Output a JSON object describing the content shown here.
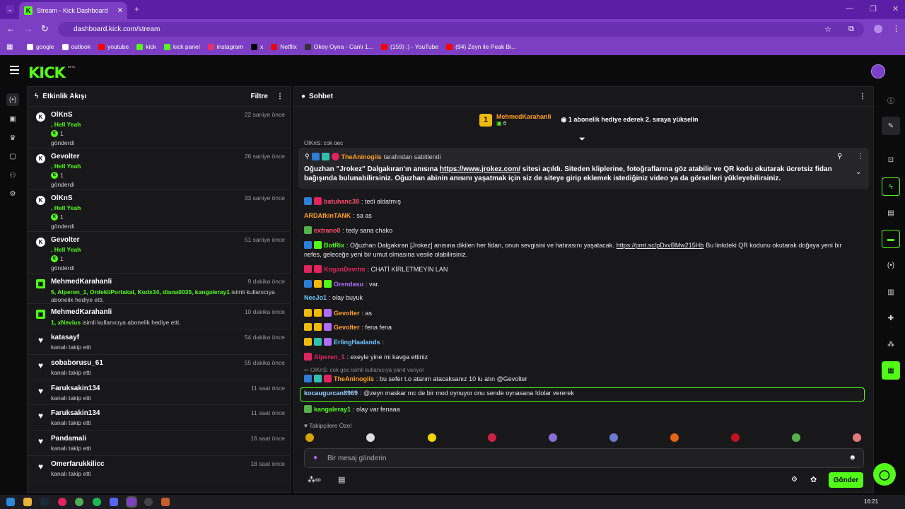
{
  "browser": {
    "tab_title": "Stream - Kick Dashboard",
    "url": "dashboard.kick.com/stream",
    "bookmarks": [
      {
        "label": "google",
        "color": "#ffffff"
      },
      {
        "label": "outlook",
        "color": "#ffffff"
      },
      {
        "label": "youtube",
        "color": "#ff0000"
      },
      {
        "label": "kick",
        "color": "#53fc18"
      },
      {
        "label": "kick panel",
        "color": "#53fc18"
      },
      {
        "label": "instagram",
        "color": "#e1306c"
      },
      {
        "label": "x",
        "color": "#000000"
      },
      {
        "label": "Netflix",
        "color": "#e50914"
      },
      {
        "label": "Okey Oyna - Canlı 1...",
        "color": "#333333"
      },
      {
        "label": "(159) :) - YouTube",
        "color": "#ff0000"
      },
      {
        "label": "(94) Zeyn ile Peak Bi...",
        "color": "#ff0000"
      }
    ]
  },
  "kick": {
    "logo": "KICK",
    "beta": "BETA"
  },
  "activity": {
    "title": "Etkinlik Akışı",
    "filter": "Filtre",
    "items": [
      {
        "type": "kicks",
        "name": "OlKnS",
        "time": "22 saniye önce",
        "line2": ", Hell Yeah",
        "count": "1",
        "line4": "gönderdi"
      },
      {
        "type": "kicks",
        "name": "Gevolter",
        "time": "26 saniye önce",
        "line2": ", Hell Yeah",
        "count": "1",
        "line4": "gönderdi"
      },
      {
        "type": "kicks",
        "name": "OlKnS",
        "time": "33 saniye önce",
        "line2": ", Hell Yeah",
        "count": "1",
        "line4": "gönderdi"
      },
      {
        "type": "kicks",
        "name": "Gevolter",
        "time": "51 saniye önce",
        "line2": ", Hell Yeah",
        "count": "1",
        "line4": "gönderdi"
      },
      {
        "type": "gift",
        "name": "MehmedKarahanli",
        "time": "9 dakika önce",
        "line2": "5, Alperen_1, OrdekliPortakal, Kodx34, diana0035, kangaleray1",
        "line2b": " isimli kullanıcıya",
        "line3": "abonelik hediye etti."
      },
      {
        "type": "gift",
        "name": "MehmedKarahanli",
        "time": "10 dakika önce",
        "line2": "1, xNevius",
        "line2b": " isimli kullanıcıya abonelik hediye etti."
      },
      {
        "type": "follow",
        "name": "katasayf",
        "time": "54 dakika önce",
        "line2": "kanalı takip etti"
      },
      {
        "type": "follow",
        "name": "sobaborusu_61",
        "time": "55 dakika önce",
        "line2": "kanalı takip etti"
      },
      {
        "type": "follow",
        "name": "Faruksakin134",
        "time": "11 saat önce",
        "line2": "kanalı takip etti"
      },
      {
        "type": "follow",
        "name": "Faruksakin134",
        "time": "11 saat önce",
        "line2": "kanalı takip etti"
      },
      {
        "type": "follow",
        "name": "Pandamali",
        "time": "16 saat önce",
        "line2": "kanalı takip etti"
      },
      {
        "type": "follow",
        "name": "Omerfarukkilicc",
        "time": "18 saat önce",
        "line2": "kanalı takip etti"
      }
    ]
  },
  "chat": {
    "title": "Sohbet",
    "top_user": "MehmedKarahanli",
    "top_rank": "1",
    "top_count": "6",
    "top_text": "1 abonelik hediye ederek 2. sıraya yükselin",
    "pinned_by": "TheAninogiis",
    "pinned_suffix": "tarafından sabitlendi",
    "pinned_pre": "Oğuzhan \"Jrokez\" Dalgakıran'ın anısına ",
    "pinned_link": "https://www.jrokez.com/",
    "pinned_post": " sitesi açıldı. Siteden kliplerine, fotoğraflarına göz atabilir ve QR kodu okutarak ücretsiz fidan bağışında bulunabilirsiniz. Oğuzhan abinin anısını yaşatmak için siz de siteye girip eklemek istediğiniz video ya da görselleri yükleyebilirsiniz.",
    "peek_above": "OlKnS: cok gec",
    "messages": [
      {
        "user": "batuhanc38",
        "color": "#ff4d6d",
        "text": ": tedi aldatmış"
      },
      {
        "user": "ARDAfkinTANK",
        "color": "#ff9f1c",
        "text": ": sa as"
      },
      {
        "user": "extrano0",
        "color": "#ff4d6d",
        "text": ": tedy sana chako"
      },
      {
        "user": "BotRix",
        "color": "#53fc18",
        "text": ": Oğuzhan Dalgakıran [Jrokez] anısına dikilen her fidan, onun sevgisini ve hatırasını yaşatacak. ",
        "link": "https://prnt.sc/pDxvBMw215Hb",
        "text2": " Bu linkdeki QR kodunu okutarak doğaya yeni bir",
        "line2": "nefes, geleceğe yeni bir umut olmasına vesile olabilirsiniz."
      },
      {
        "user": "KoganDevrim",
        "color": "#e0245e",
        "text": ": CHATİ KİRLETMEYİN LAN"
      },
      {
        "user": "Orendasu",
        "color": "#b06bff",
        "text": ": var."
      },
      {
        "user": "NeeJo1",
        "color": "#6ec6ff",
        "text": ": olay buyuk"
      },
      {
        "user": "Gevolter",
        "color": "#ff9f1c",
        "text": ": as"
      },
      {
        "user": "Gevolter",
        "color": "#ff9f1c",
        "text": ": fena fena"
      },
      {
        "user": "ErlingHaalands",
        "color": "#6ec6ff",
        "text": ":"
      },
      {
        "user": "Alperen_1",
        "color": "#e0245e",
        "text": ": exeyle yine mi kavga ettiniz"
      },
      {
        "user": "TheAninogiis",
        "color": "#ff9f1c",
        "text": ": bu sefer t.o atarım atacaksanız 10 lu atın @Gevolter"
      },
      {
        "user": "kocaugurcan8969",
        "color": "#9ad1ff",
        "text": ": @zeyn maskar mc de bir mod oynuyor onu sende oynasana !dolar vererek"
      },
      {
        "user": "kangaleray1",
        "color": "#53fc18",
        "text": ": olay var fenaaa"
      }
    ],
    "reply_note": "OlKnS: cok gec isimli kullanıcıya yanıt veriyor",
    "followers_only": "Takipçilere Özel",
    "input_placeholder": "Bir mesaj gönderin",
    "send": "Gönder"
  },
  "taskbar": {
    "time": "16:21"
  },
  "colors": {
    "accent": "#53fc18",
    "browser": "#7c3fc4"
  }
}
